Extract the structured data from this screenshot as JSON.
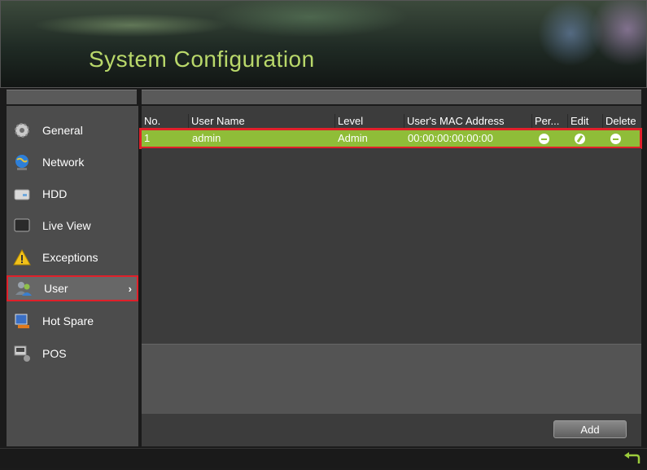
{
  "header": {
    "title": "System Configuration"
  },
  "sidebar": {
    "items": [
      {
        "label": "General",
        "icon": "gear-monitor-icon"
      },
      {
        "label": "Network",
        "icon": "globe-network-icon"
      },
      {
        "label": "HDD",
        "icon": "hard-drive-icon"
      },
      {
        "label": "Live View",
        "icon": "monitor-icon"
      },
      {
        "label": "Exceptions",
        "icon": "warning-icon"
      },
      {
        "label": "User",
        "icon": "users-icon",
        "active": true,
        "arrow": "›"
      },
      {
        "label": "Hot Spare",
        "icon": "hot-spare-icon"
      },
      {
        "label": "POS",
        "icon": "pos-terminal-icon"
      }
    ]
  },
  "table": {
    "columns": [
      "No.",
      "User Name",
      "Level",
      "User's MAC Address",
      "Per...",
      "Edit",
      "Delete"
    ],
    "rows": [
      {
        "no": "1",
        "user_name": "admin",
        "level": "Admin",
        "mac": "00:00:00:00:00:00",
        "permission_icon": "minus-circle-icon",
        "edit_icon": "pencil-circle-icon",
        "delete_icon": "minus-circle-icon"
      }
    ]
  },
  "buttons": {
    "add": "Add"
  },
  "colors": {
    "selected_row": "#8fbd38",
    "highlight": "#e0202a",
    "title": "#b9d86a"
  }
}
